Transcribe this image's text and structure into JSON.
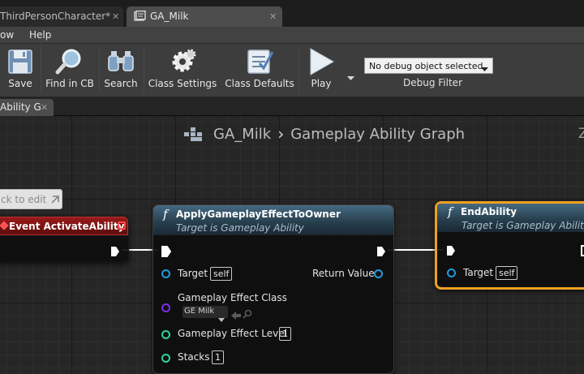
{
  "tabs": [
    {
      "label": "ThirdPersonCharacter*",
      "close": "✕"
    },
    {
      "label": "GA_Milk",
      "close": "✕"
    }
  ],
  "menu": [
    "ow",
    "Help"
  ],
  "toolbar": {
    "save": "Save",
    "find_in_cb": "Find in CB",
    "search": "Search",
    "class_settings": "Class Settings",
    "class_defaults": "Class Defaults",
    "play": "Play",
    "debug_select": "No debug object selected",
    "debug_filter": "Debug Filter"
  },
  "graph_tab": {
    "label": "Ability G",
    "close": "✕"
  },
  "breadcrumb": {
    "blueprint": "GA_Milk",
    "separator": "›",
    "graph": "Gameplay Ability Graph",
    "edge_text": "Z"
  },
  "comment": {
    "text": "ck to edit"
  },
  "nodes": {
    "event": {
      "title": "Event ActivateAbility"
    },
    "apply_effect": {
      "title": "ApplyGameplayEffectToOwner",
      "subtitle": "Target is Gameplay Ability",
      "target_label": "Target",
      "target_value": "self",
      "return_label": "Return Value",
      "effect_class_label": "Gameplay Effect Class",
      "effect_class_value": "GE Milk",
      "level_label": "Gameplay Effect Level",
      "level_value": "1",
      "stacks_label": "Stacks",
      "stacks_value": "1"
    },
    "end_ability": {
      "title": "EndAbility",
      "subtitle": "Target is Gameplay Ability",
      "target_label": "Target",
      "target_value": "self"
    }
  },
  "colors": {
    "exec_wire": "#ffffff",
    "object_pin": "#1f9be0",
    "class_pin": "#7a2ee6",
    "int_pin": "#2bd4a2",
    "event_header": "#7a0f0f",
    "function_header": "#2f4a5c",
    "selection": "#f0a020"
  }
}
